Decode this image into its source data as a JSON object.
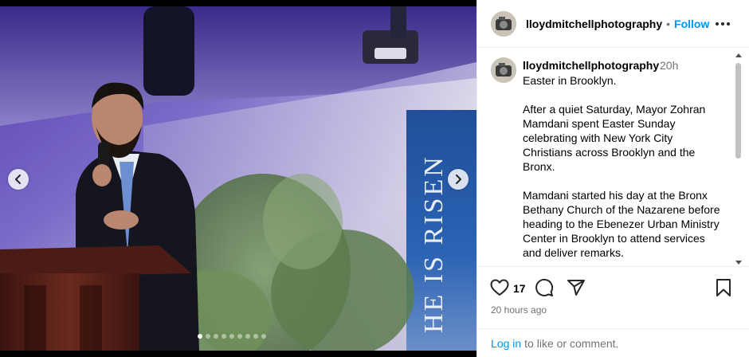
{
  "post": {
    "username": "lloydmitchellphotography",
    "follow_label": "Follow",
    "separator": "•",
    "caption_time": "20h",
    "caption": "Easter in Brooklyn.\n\nAfter a quiet Saturday, Mayor Zohran Mamdani spent Easter Sunday celebrating with New York City Christians across Brooklyn and the Bronx.\n\nMamdani started his day at the Bronx Bethany Church of the Nazarene before heading to the Ebenezer Urban Ministry Center in Brooklyn to attend services and deliver remarks.",
    "like_count": "17",
    "time_ago": "20 hours ago",
    "banner_text": "HE IS RISEN"
  },
  "footer": {
    "login_label": "Log in",
    "rest_label": "to like or comment."
  },
  "carousel": {
    "slide_count": 9,
    "active_slide": 1
  },
  "icons": {
    "prev": "chevron-left-icon",
    "next": "chevron-right-icon",
    "more": "more-horizontal-icon",
    "like": "heart-icon",
    "comment": "comment-icon",
    "share": "share-icon",
    "save": "bookmark-icon"
  },
  "colors": {
    "accent": "#0095f6",
    "muted": "#737373",
    "border": "#efefef"
  }
}
